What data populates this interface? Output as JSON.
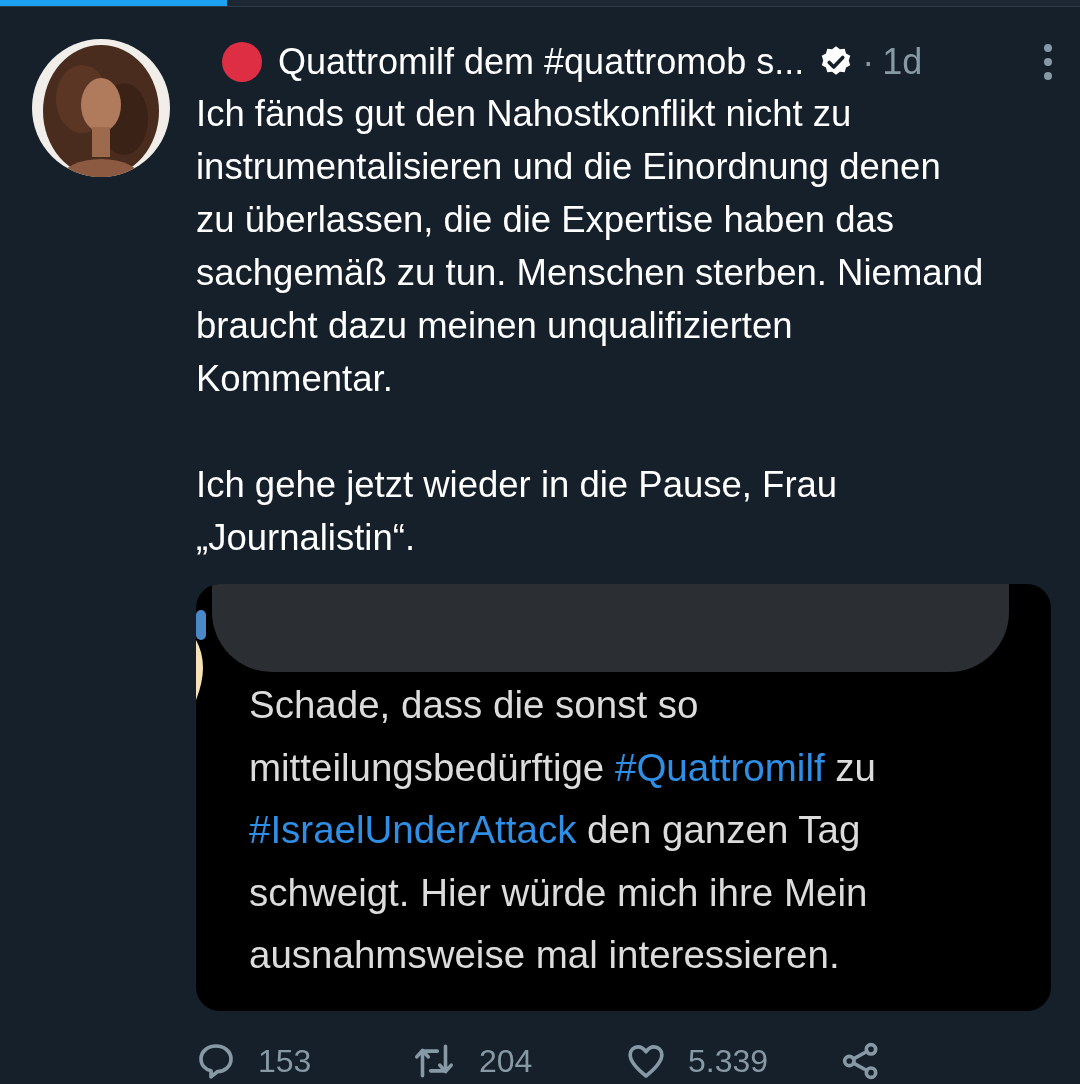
{
  "load_progress": {
    "level": 0.21
  },
  "tweet": {
    "status_emoji": {
      "color": "#dd2e44"
    },
    "author": "Quattromilf dem #quattromob s...",
    "verified": true,
    "separator": "·",
    "time": "1d",
    "text": "Ich fänds gut den Nahostkonflikt nicht zu\ninstrumentalisieren und die Einordnung denen\nzu überlassen, die die Expertise haben das\nsachgemäß zu tun. Menschen sterben. Niemand\nbraucht dazu meinen unqualifizierten\nKommentar.\n\nIch gehe jetzt wieder in die Pause, Frau\n„Journalistin“.",
    "attached_screenshot": {
      "lines": [
        [
          {
            "kind": "plain",
            "text": "Schade, dass die sonst so"
          }
        ],
        [
          {
            "kind": "plain",
            "text": "mitteilungsbedürftige "
          },
          {
            "kind": "hashtag",
            "text": "#Quattromilf"
          },
          {
            "kind": "plain",
            "text": " zu"
          }
        ],
        [
          {
            "kind": "hashtag",
            "text": "#IsraelUnderAttack"
          },
          {
            "kind": "plain",
            "text": " den ganzen Tag"
          }
        ],
        [
          {
            "kind": "plain",
            "text": "schweigt. Hier würde mich ihre Mein"
          }
        ],
        [
          {
            "kind": "plain",
            "text": "ausnahmsweise mal interessieren."
          }
        ]
      ]
    },
    "actions": [
      {
        "kind": "reply",
        "count": "153"
      },
      {
        "kind": "retweet",
        "count": "204"
      },
      {
        "kind": "like",
        "count": "5.339"
      },
      {
        "kind": "share"
      }
    ]
  }
}
